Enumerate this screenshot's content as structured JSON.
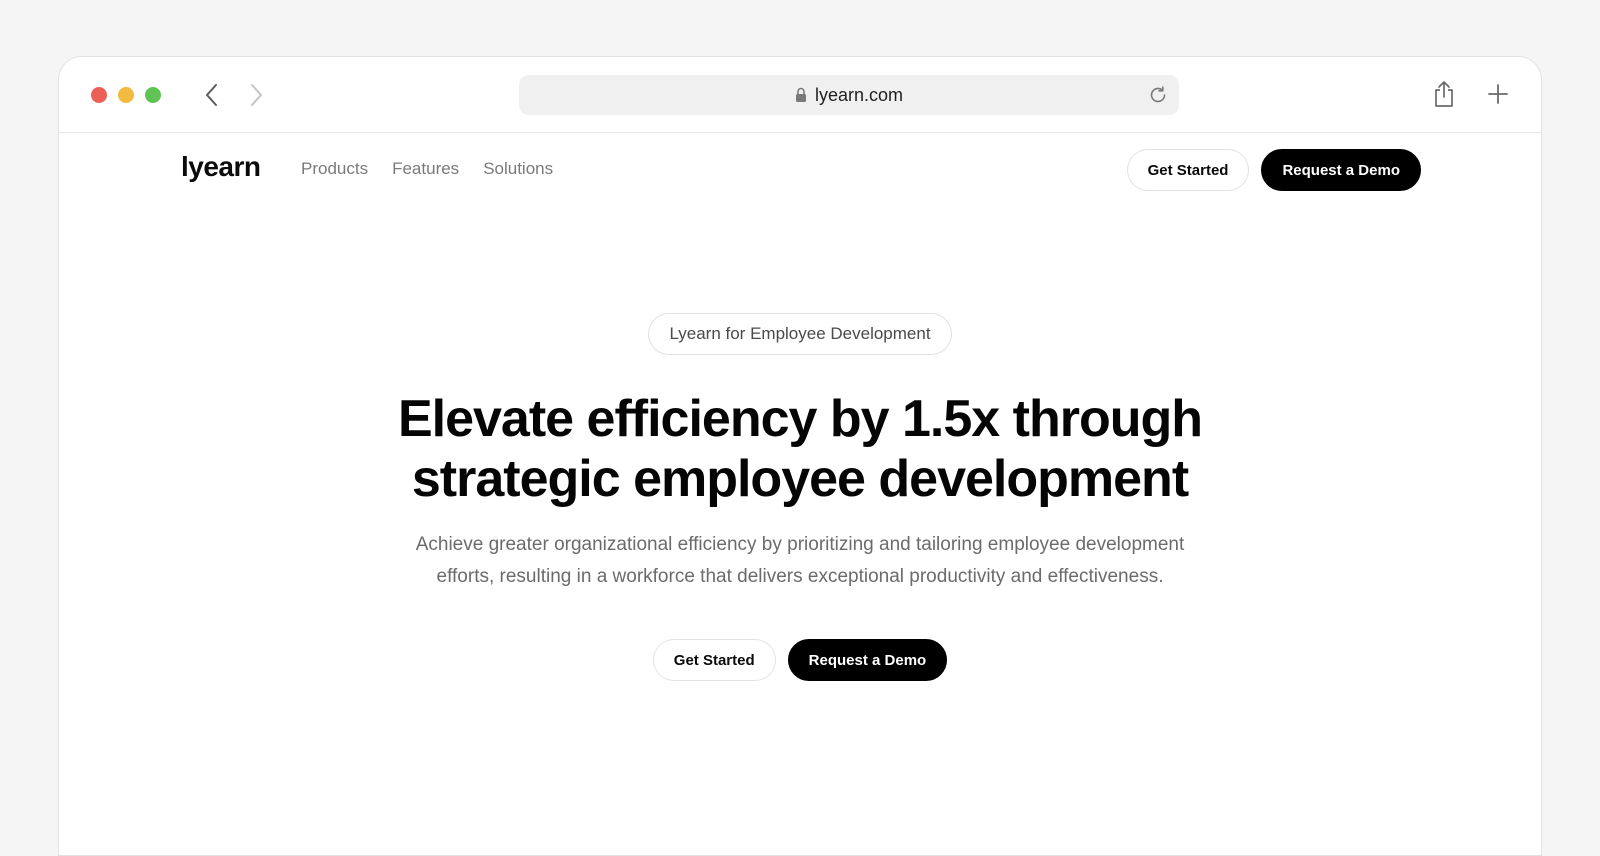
{
  "browser": {
    "url": "lyearn.com",
    "colors": {
      "close": "#ec5f57",
      "minimize": "#f2bb3f",
      "maximize": "#5fc454"
    }
  },
  "nav": {
    "logo": "lyearn",
    "items": [
      {
        "label": "Products"
      },
      {
        "label": "Features"
      },
      {
        "label": "Solutions"
      }
    ],
    "get_started": "Get Started",
    "request_demo": "Request a Demo"
  },
  "hero": {
    "eyebrow": "Lyearn for Employee Development",
    "headline_line1": "Elevate efficiency by 1.5x through",
    "headline_line2": "strategic employee development",
    "subtitle_line1": "Achieve greater organizational efficiency by prioritizing and tailoring employee development",
    "subtitle_line2": "efforts, resulting in a workforce that delivers exceptional productivity and effectiveness.",
    "get_started": "Get Started",
    "request_demo": "Request a Demo"
  }
}
